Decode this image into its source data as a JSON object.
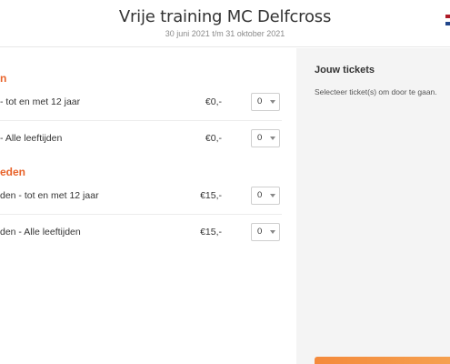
{
  "header": {
    "title": "Vrije training MC Delfcross",
    "subtitle": "30 juni 2021 t/m 31 oktober 2021"
  },
  "categories": [
    {
      "label": "n"
    },
    {
      "label": "eden"
    }
  ],
  "tickets": [
    {
      "name": "- tot en met 12 jaar",
      "price": "€0,-",
      "quantity": "0"
    },
    {
      "name": "- Alle leeftijden",
      "price": "€0,-",
      "quantity": "0"
    },
    {
      "name": "den - tot en met 12 jaar",
      "price": "€15,-",
      "quantity": "0"
    },
    {
      "name": "den - Alle leeftijden",
      "price": "€15,-",
      "quantity": "0"
    }
  ],
  "sidebar": {
    "title": "Jouw tickets",
    "message": "Selecteer ticket(s) om door te gaan."
  },
  "colors": {
    "accent": "#e8632a",
    "button": "#f48a3c",
    "sidebar_bg": "#f4f4f4"
  }
}
